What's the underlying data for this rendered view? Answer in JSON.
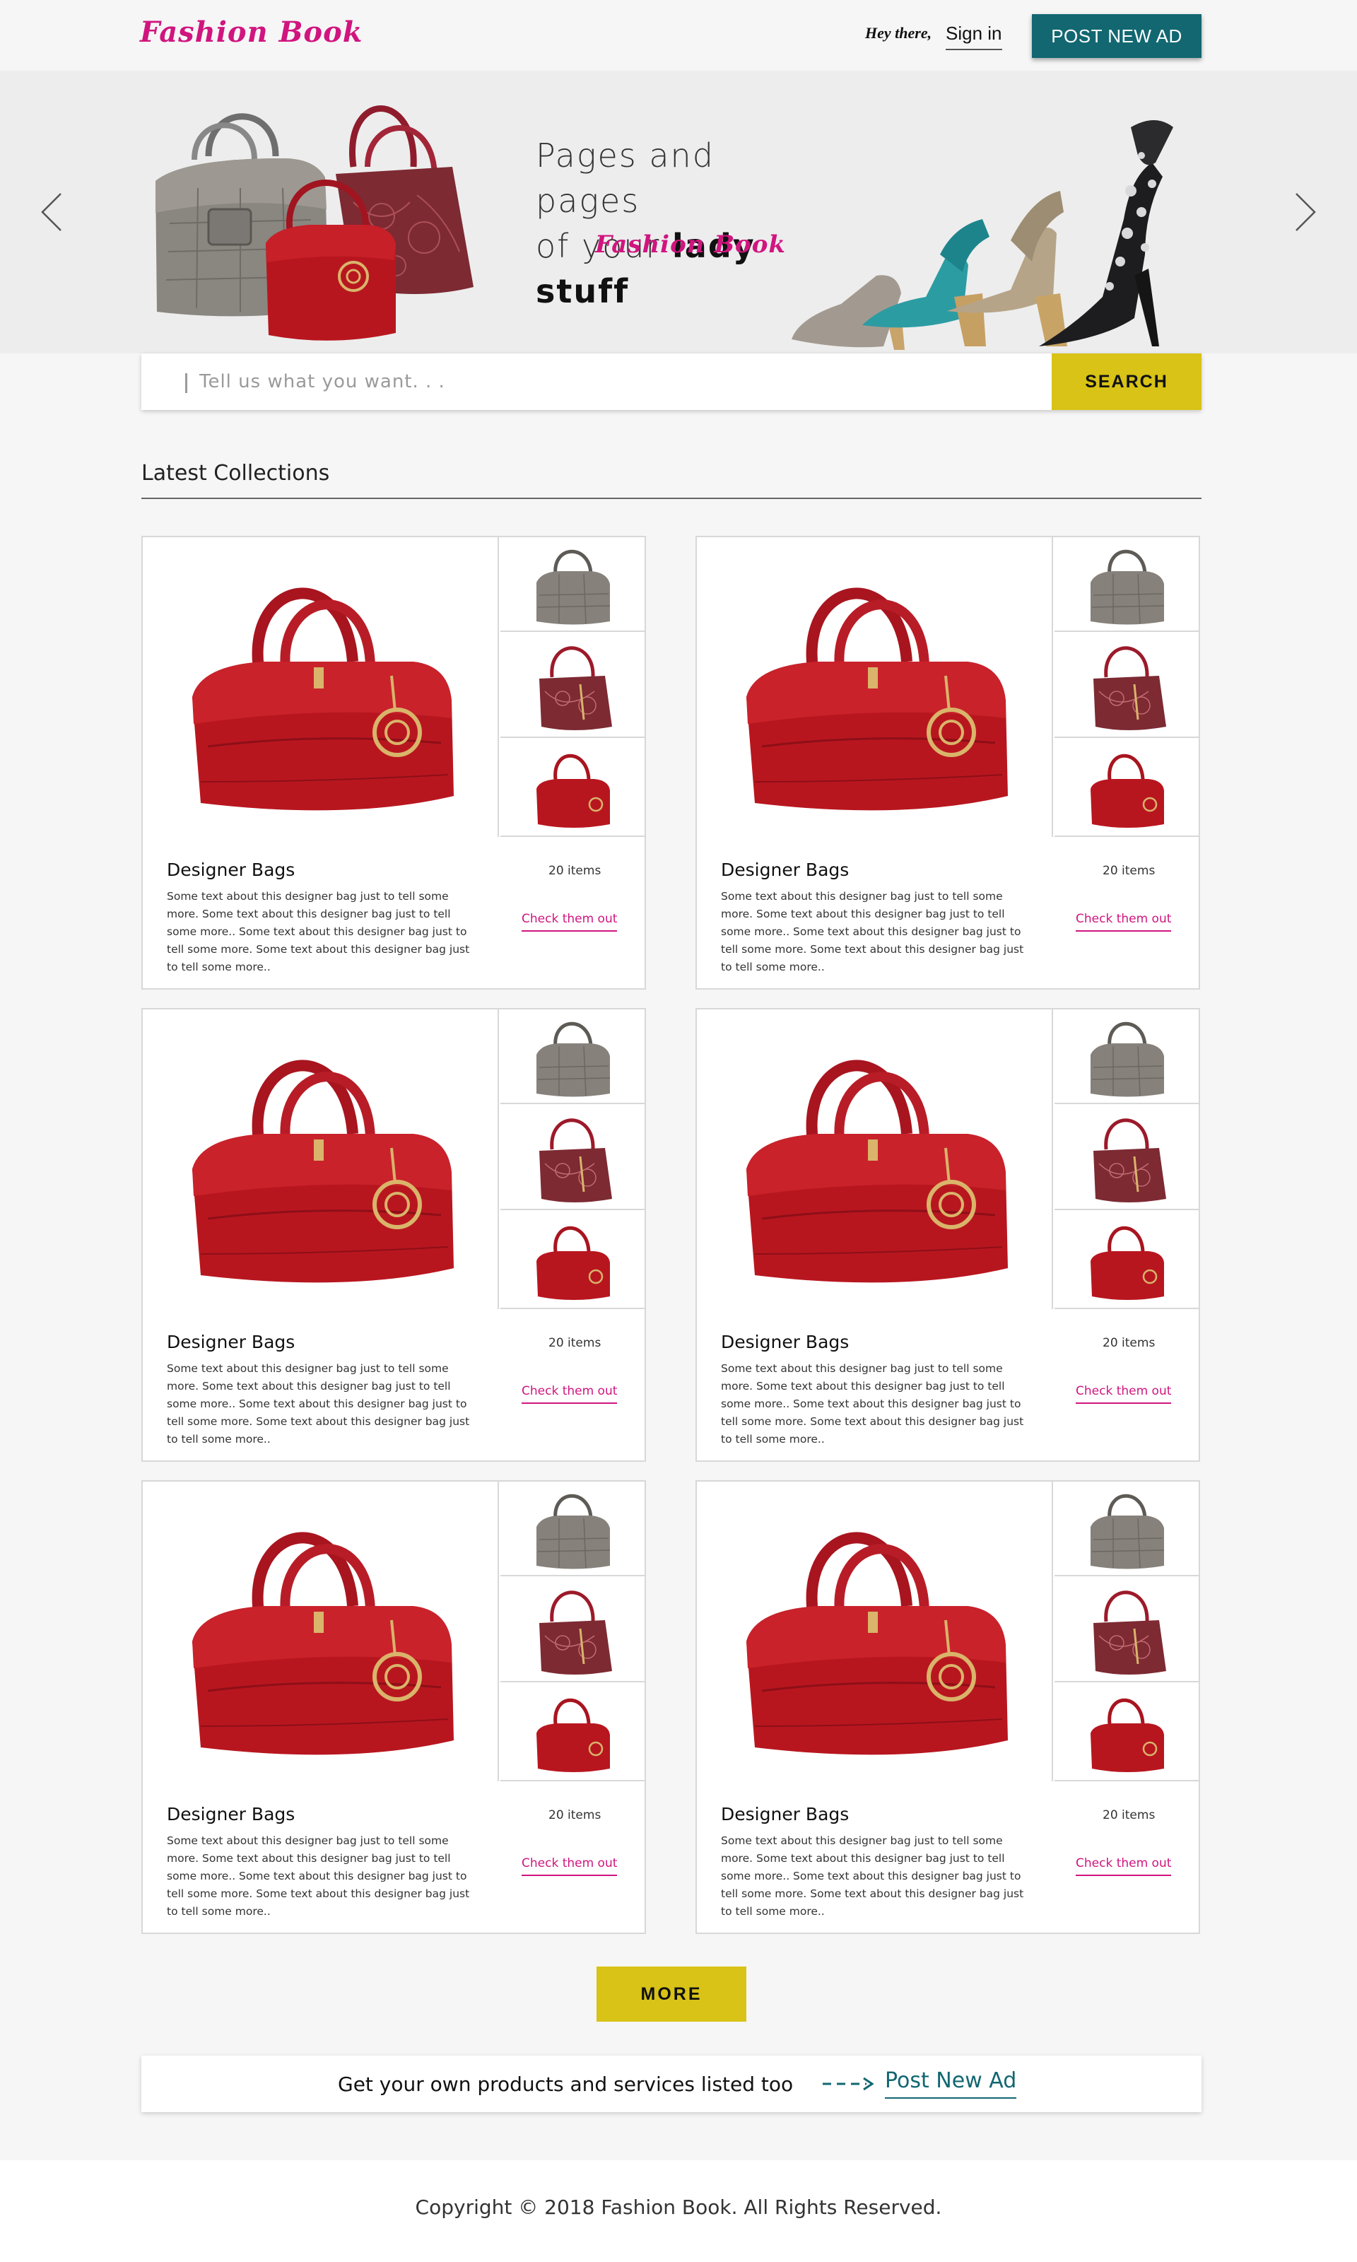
{
  "header": {
    "logo": "Fashion Book",
    "greeting": "Hey there,",
    "signin_label": "Sign in",
    "post_ad_label": "POST NEW AD"
  },
  "hero": {
    "line1_light": "Pages and pages",
    "line2_light": "of your ",
    "line2_bold": "lady stuff",
    "brand": "Fashion Book",
    "prev_icon": "chevron-left-icon",
    "next_icon": "chevron-right-icon"
  },
  "search": {
    "placeholder": "Tell us what you want. . .",
    "value": "",
    "button_label": "SEARCH"
  },
  "section": {
    "title": "Latest Collections"
  },
  "cards": [
    {
      "title": "Designer Bags",
      "count": "20 items",
      "description": "Some text about this designer bag just to tell some more. Some text about this designer bag just to tell some more.. Some text about this designer bag just to tell some more. Some text about this designer bag just to tell some more..",
      "link": "Check them out"
    },
    {
      "title": "Designer Bags",
      "count": "20 items",
      "description": "Some text about this designer bag just to tell some more. Some text about this designer bag just to tell some more.. Some text about this designer bag just to tell some more. Some text about this designer bag just to tell some more..",
      "link": "Check them out"
    },
    {
      "title": "Designer Bags",
      "count": "20 items",
      "description": "Some text about this designer bag just to tell some more. Some text about this designer bag just to tell some more.. Some text about this designer bag just to tell some more. Some text about this designer bag just to tell some more..",
      "link": "Check them out"
    },
    {
      "title": "Designer Bags",
      "count": "20 items",
      "description": "Some text about this designer bag just to tell some more. Some text about this designer bag just to tell some more.. Some text about this designer bag just to tell some more. Some text about this designer bag just to tell some more..",
      "link": "Check them out"
    },
    {
      "title": "Designer Bags",
      "count": "20 items",
      "description": "Some text about this designer bag just to tell some more. Some text about this designer bag just to tell some more.. Some text about this designer bag just to tell some more. Some text about this designer bag just to tell some more..",
      "link": "Check them out"
    },
    {
      "title": "Designer Bags",
      "count": "20 items",
      "description": "Some text about this designer bag just to tell some more. Some text about this designer bag just to tell some more.. Some text about this designer bag just to tell some more. Some text about this designer bag just to tell some more..",
      "link": "Check them out"
    }
  ],
  "more_label": "MORE",
  "cta": {
    "text": "Get your own products and services listed too",
    "link": "Post New Ad",
    "arrow_icon": "dashed-arrow-right-icon"
  },
  "footer": {
    "copyright": "Copyright © 2018 Fashion Book. All Rights Reserved."
  },
  "colors": {
    "brand_pink": "#d0157f",
    "brand_teal": "#126771",
    "accent_yellow": "#d8c316",
    "page_bg": "#f6f6f6"
  }
}
